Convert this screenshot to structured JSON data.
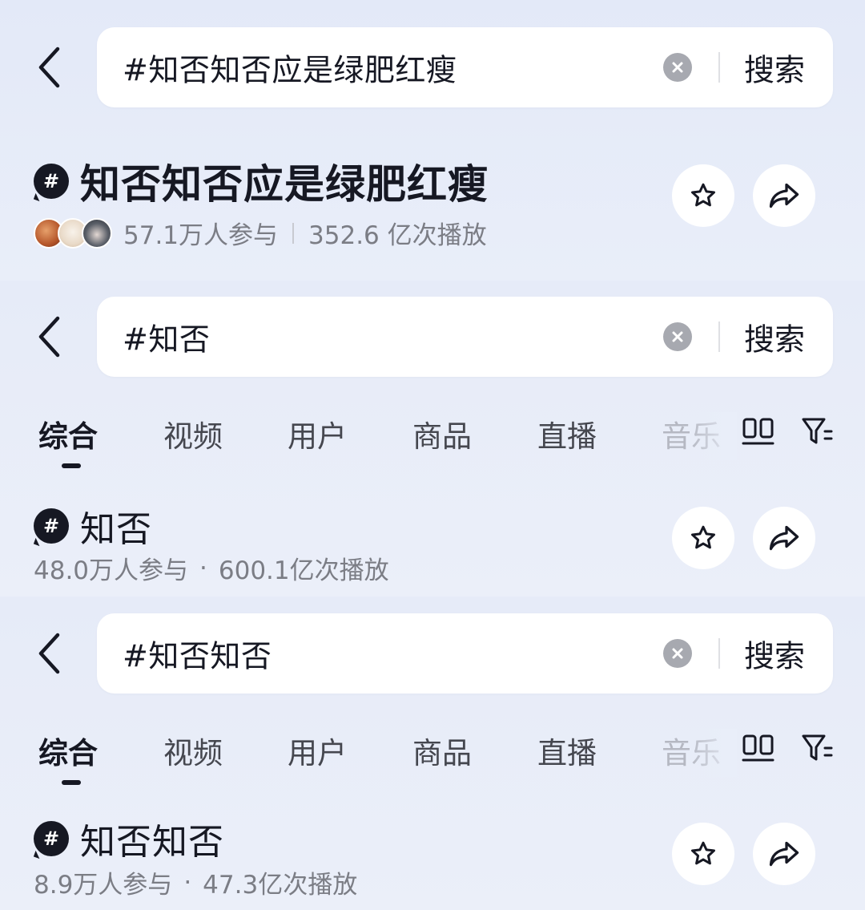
{
  "screens": [
    {
      "search": {
        "query": "#知否知否应是绿肥红瘦",
        "button_label": "搜索"
      },
      "topic": {
        "title": "知否知否应是绿肥红瘦",
        "participants": "57.1万人参与",
        "plays": "352.6 亿次播放"
      }
    },
    {
      "search": {
        "query": "#知否",
        "button_label": "搜索"
      },
      "tabs": [
        "综合",
        "视频",
        "用户",
        "商品",
        "直播",
        "音乐"
      ],
      "active_tab": "综合",
      "topic": {
        "title": "知否",
        "participants": "48.0万人参与",
        "plays": "600.1亿次播放"
      }
    },
    {
      "search": {
        "query": "#知否知否",
        "button_label": "搜索"
      },
      "tabs": [
        "综合",
        "视频",
        "用户",
        "商品",
        "直播",
        "音乐"
      ],
      "active_tab": "综合",
      "topic": {
        "title": "知否知否",
        "participants": "8.9万人参与",
        "plays": "47.3亿次播放"
      }
    }
  ],
  "hash_symbol": "#",
  "stat_dot": "·",
  "icons": {
    "back": "chevron-left-icon",
    "clear": "clear-circle-icon",
    "star": "star-outline-icon",
    "share": "share-arrow-icon",
    "layout": "double-column-icon",
    "filter": "filter-icon",
    "avatars": [
      "avatar-user-1",
      "avatar-user-2",
      "avatar-user-3"
    ]
  },
  "colors": {
    "background": "#e8edf9",
    "text_primary": "#161823",
    "text_secondary": "#7b7d85",
    "clear_button": "#a7a9b0"
  }
}
